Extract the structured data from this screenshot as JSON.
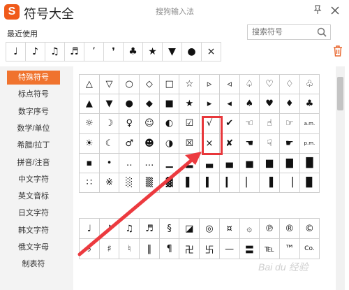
{
  "window": {
    "logo": "S",
    "title": "符号大全",
    "ime_name": "搜狗输入法",
    "pin_icon": "pin-icon",
    "close_icon": "close-icon"
  },
  "recent": {
    "label": "最近使用",
    "symbols": [
      "♩",
      "♪",
      "♫",
      "♬",
      "’",
      "❜",
      "♣",
      "★",
      "▼",
      "●",
      "×"
    ]
  },
  "search": {
    "placeholder": "搜索符号"
  },
  "categories": [
    {
      "label": "特殊符号",
      "active": true
    },
    {
      "label": "标点符号"
    },
    {
      "label": "数字序号"
    },
    {
      "label": "数学/单位"
    },
    {
      "label": "希腊/拉丁"
    },
    {
      "label": "拼音/注音"
    },
    {
      "label": "中文字符"
    },
    {
      "label": "英文音标"
    },
    {
      "label": "日文字符"
    },
    {
      "label": "韩文字符"
    },
    {
      "label": "俄文字母"
    },
    {
      "label": "制表符"
    }
  ],
  "grid_main": [
    [
      "△",
      "▽",
      "○",
      "◇",
      "□",
      "☆",
      "▹",
      "◃",
      "♤",
      "♡",
      "♢",
      "♧"
    ],
    [
      "▲",
      "▼",
      "●",
      "◆",
      "■",
      "★",
      "▸",
      "◂",
      "♠",
      "♥",
      "♦",
      "♣"
    ],
    [
      "☼",
      "☽",
      "♀",
      "☺",
      "◐",
      "☑",
      "√",
      "✔",
      "☜",
      "☝",
      "☞",
      "a.m."
    ],
    [
      "☀",
      "☾",
      "♂",
      "☻",
      "◑",
      "☒",
      "×",
      "✘",
      "☚",
      "☟",
      "☛",
      "p.m."
    ],
    [
      "▪",
      "•",
      "‥",
      "…",
      "▁",
      "▂",
      "▃",
      "▄",
      "▅",
      "▆",
      "▇",
      "█"
    ],
    [
      "∷",
      "※",
      "░",
      "▒",
      "▓",
      "▌",
      "▍",
      "▎",
      "▏",
      "▐",
      "▕",
      "▉"
    ]
  ],
  "grid_second": [
    [
      "♩",
      "♪",
      "♫",
      "♬",
      "§",
      "◪",
      "◎",
      "¤",
      "۞",
      "℗",
      "®",
      "©"
    ],
    [
      "♭",
      "♯",
      "♮",
      "‖",
      "¶",
      "卍",
      "卐",
      "—",
      "〓",
      "℡",
      "™",
      "Co."
    ]
  ],
  "watermark": "Bai du 经验"
}
